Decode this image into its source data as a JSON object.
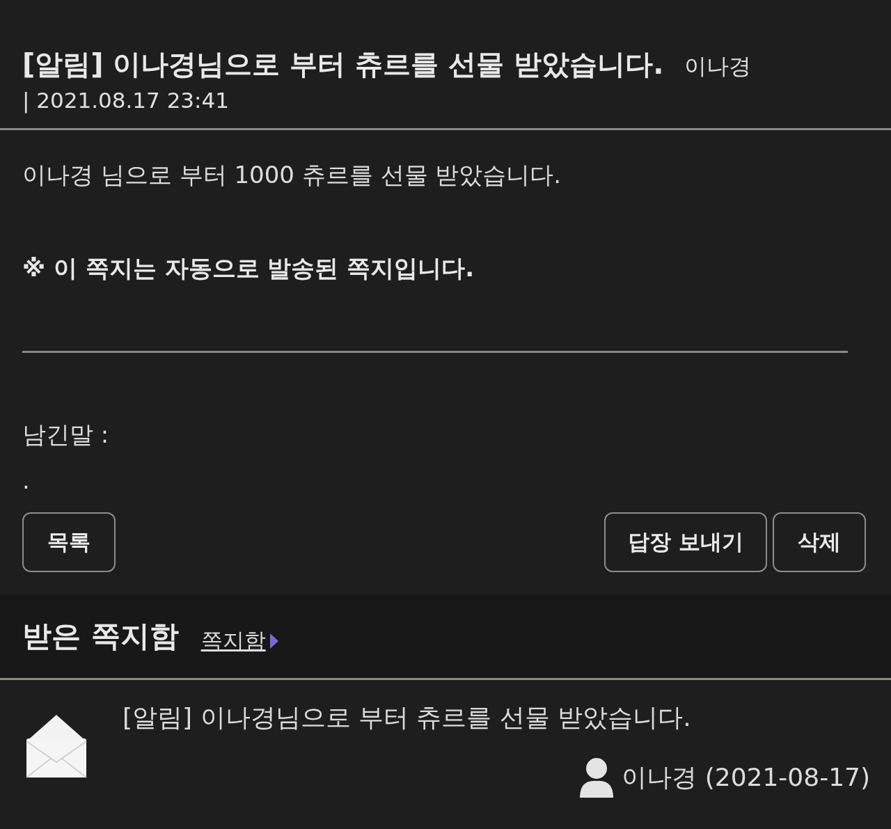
{
  "message": {
    "title": "[알림] 이나경님으로 부터 츄르를 선물 받았습니다.",
    "author": "이나경",
    "date": "| 2021.08.17 23:41",
    "body": "이나경 님으로 부터 1000 츄르를 선물 받았습니다.",
    "notice": "※ 이 쪽지는 자동으로 발송된 쪽지입니다.",
    "comment_label": "남긴말 :",
    "comment": "."
  },
  "buttons": {
    "left": [
      "목록"
    ],
    "right": [
      "답장 보내기",
      "삭제"
    ]
  },
  "inbox": {
    "title": "받은 쪽지함",
    "link": "쪽지함",
    "items": [
      {
        "subject": "[알림] 이나경님으로 부터 츄르를 선물 받았습니다.",
        "sender": "이나경 (2021-08-17)",
        "read": true
      }
    ]
  }
}
